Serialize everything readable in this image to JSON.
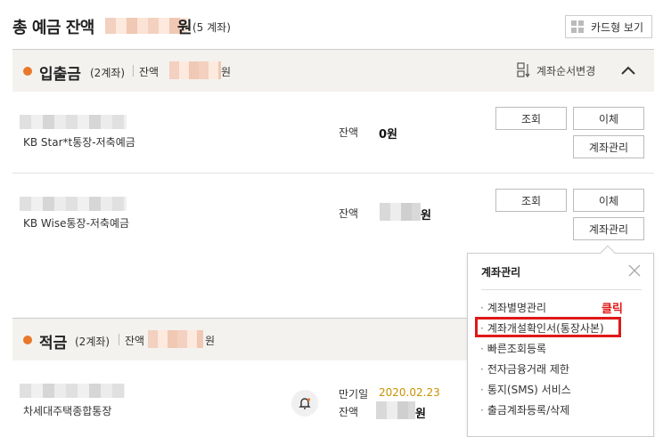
{
  "header": {
    "title": "총 예금 잔액",
    "won": "원",
    "count": "(5 계좌)",
    "card_view_label": "카드형 보기"
  },
  "deposit_section": {
    "name": "입출금",
    "count": "(2계좌)",
    "balance_label": "잔액",
    "won": "원",
    "reorder_label": "계좌순서변경"
  },
  "accounts": [
    {
      "name": "KB Star*t통장-저축예금",
      "balance_label": "잔액",
      "balance_value": "0원",
      "btn_inquiry": "조회",
      "btn_transfer": "이체",
      "btn_manage": "계좌관리"
    },
    {
      "name": "KB Wise통장-저축예금",
      "balance_label": "잔액",
      "balance_won": "원",
      "btn_inquiry": "조회",
      "btn_transfer": "이체",
      "btn_manage": "계좌관리"
    }
  ],
  "savings_section": {
    "name": "적금",
    "count": "(2계좌)",
    "balance_label": "잔액",
    "won": "원"
  },
  "savings_account": {
    "name": "차세대주택종합통장",
    "maturity_label": "만기일",
    "maturity_date": "2020.02.23",
    "balance_label": "잔액",
    "balance_won": "원"
  },
  "popup": {
    "title": "계좌관리",
    "items": [
      "계좌별명관리",
      "계좌개설확인서(통장사본)",
      "빠른조회등록",
      "전자금융거래 제한",
      "통지(SMS) 서비스",
      "출금계좌등록/삭제"
    ],
    "bullet": "·"
  },
  "annotation": {
    "click_label": "클릭"
  },
  "colors": {
    "accent": "#e9782a",
    "highlight": "#e01818",
    "date": "#c79200"
  },
  "icons": [
    "grid-icon",
    "reorder-icon",
    "chevron-up-icon",
    "close-icon",
    "bell-icon"
  ]
}
